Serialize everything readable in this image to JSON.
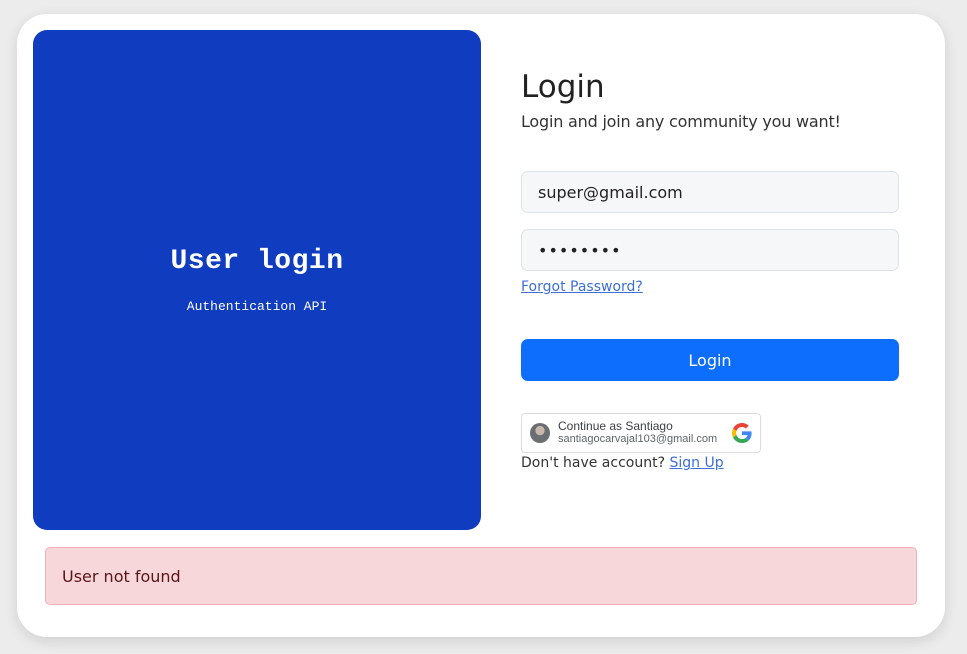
{
  "hero": {
    "title": "User login",
    "subtitle": "Authentication API"
  },
  "form": {
    "title": "Login",
    "subtitle": "Login and join any community you want!",
    "email_value": "super@gmail.com",
    "password_mask": "••••••••",
    "forgot_label": "Forgot Password?",
    "login_label": "Login"
  },
  "google": {
    "name_label": "Continue as Santiago",
    "email": "santiagocarvajal103@gmail.com",
    "icon": "google-g-icon"
  },
  "signup": {
    "prompt": "Don't have account? ",
    "link_label": "Sign Up"
  },
  "alert": {
    "message": "User not found"
  },
  "colors": {
    "hero_bg": "#103cbf",
    "primary": "#0d6efd",
    "alert_bg": "#f8d7da",
    "link": "#3d6fd8"
  }
}
